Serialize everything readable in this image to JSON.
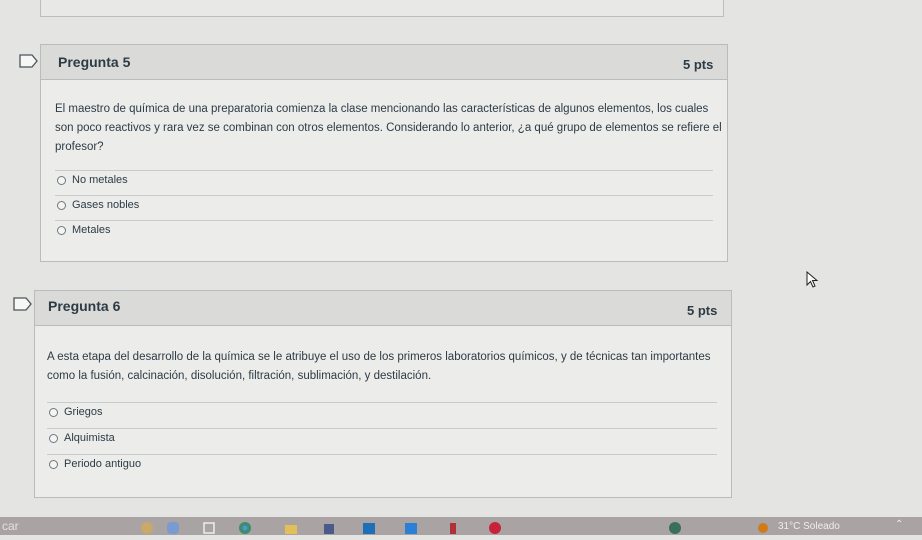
{
  "questions": [
    {
      "title": "Pregunta 5",
      "points": "5 pts",
      "text_lines": [
        "El maestro de química de una preparatoria comienza la clase mencionando las características de algunos elementos, los cuales",
        "son poco reactivos y rara vez se combinan con otros elementos. Considerando lo anterior, ¿a qué grupo de elementos se refiere el",
        "profesor?"
      ],
      "answers": [
        "No metales",
        "Gases nobles",
        "Metales"
      ]
    },
    {
      "title": "Pregunta 6",
      "points": "5 pts",
      "text_lines": [
        "A esta etapa del desarrollo de la química se le atribuye el uso de los primeros laboratorios químicos, y de técnicas tan importantes",
        "como la fusión, calcinación, disolución, filtración, sublimación, y destilación."
      ],
      "answers": [
        "Griegos",
        "Alquimista",
        "Periodo antiguo"
      ]
    }
  ],
  "taskbar": {
    "search_text": "car",
    "weather_text": "31°C  Soleado",
    "icons": [
      "leaf-widget-icon",
      "copilot-icon",
      "file-explorer-icon",
      "chrome-icon",
      "folder-icon",
      "store-icon",
      "outlook-icon",
      "teams-icon",
      "app-icon",
      "opera-icon",
      "network-icon",
      "notification-icon"
    ]
  }
}
